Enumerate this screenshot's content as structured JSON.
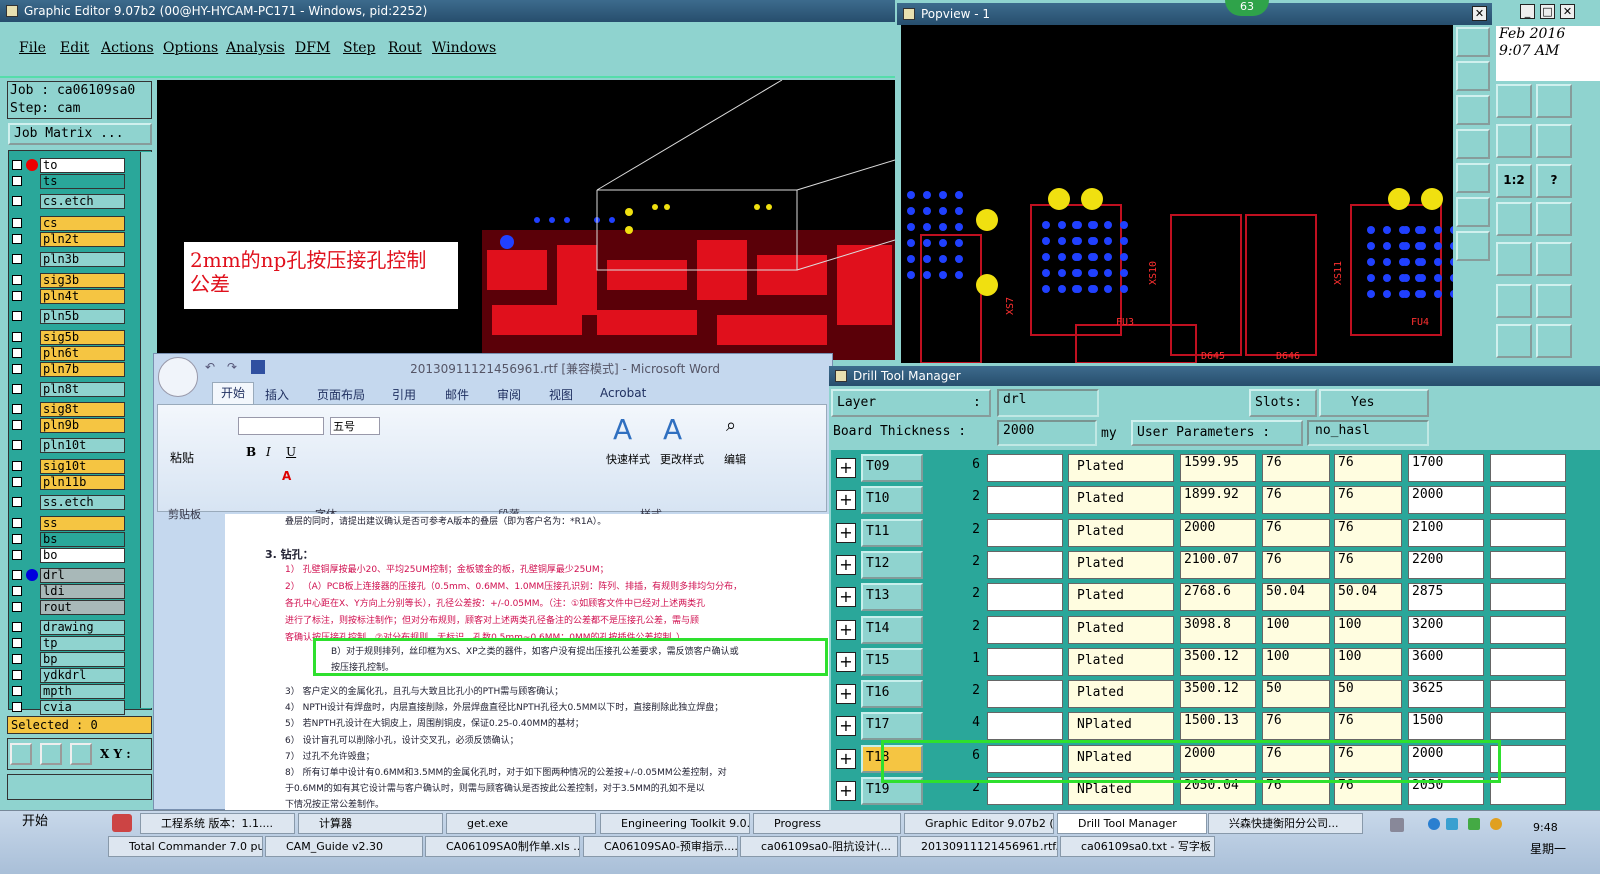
{
  "ge": {
    "title": "Graphic Editor 9.07b2 (00@HY-HYCAM-PC171 - Windows, pid:2252)",
    "menu": [
      "File",
      "Edit",
      "Actions",
      "Options",
      "Analysis",
      "DFM",
      "Step",
      "Rout",
      "Windows"
    ],
    "job": "Job : ca06109sa0",
    "step": "Step: cam",
    "job_matrix": "Job Matrix ...",
    "layers": [
      "to",
      "ts",
      "cs.etch",
      "cs",
      "pln2t",
      "pln3b",
      "sig3b",
      "pln4t",
      "pln5b",
      "sig5b",
      "pln6t",
      "pln7b",
      "pln8t",
      "sig8t",
      "pln9b",
      "pln10t",
      "sig10t",
      "pln11b",
      "ss.etch",
      "ss",
      "bs",
      "bo",
      "drl",
      "ldi",
      "rout",
      "drawing",
      "tp",
      "bp",
      "ydkdrl",
      "mpth",
      "cvia"
    ],
    "selected": "Selected : 0",
    "xy": "X Y :",
    "note": "2mm的np孔按压接孔控制\n公差"
  },
  "popview": {
    "title": "Popview - 1",
    "badge": "63",
    "labels": [
      "XS7",
      "XS10",
      "XS11",
      "FU3",
      "FU4",
      "D645",
      "D646"
    ],
    "date": "Feb 2016",
    "time": "9:07 AM"
  },
  "word": {
    "title": "20130911121456961.rtf [兼容模式] - Microsoft Word",
    "tabs": [
      "开始",
      "插入",
      "页面布局",
      "引用",
      "邮件",
      "审阅",
      "视图",
      "Acrobat"
    ],
    "groups": [
      "剪贴板",
      "字体",
      "段落",
      "样式",
      "编辑"
    ],
    "paste": "粘贴",
    "fontsize": "五号",
    "quick_style": "快速样式",
    "change_style": "更改样式",
    "edit": "编辑",
    "lines": [
      "叠层的同时，请提出建议确认是否可参考A版本的叠层（即为客户名为：*R1A）。",
      "3.   钻孔：",
      "1） 孔壁铜厚按最小20、平均25UM控制；金板镀金的板，孔壁铜厚最少25UM；",
      "2） （A）PCB板上连接器的压接孔（0.5mm、0.6MM、1.0MM压接孔识别：阵列、排插，有规则多排均匀分布，",
      "各孔中心距在X、Y方向上分别等长），孔径公差按：+/-0.05MM。（注：①如顾客文件中已经对上述两类孔",
      "进行了标注，则按标注制作；但对分布规则，顾客对上述两类孔径备注的公差都不是压接孔公差，需与顾",
      "客确认按压接孔控制。②对分布规则、无标识、孔数0.5mm~0.6MM：0MM的孔按插件公差控制。）",
      "B）对于规则排列，丝印框为XS、XP之类的器件，如客户没有提出压接孔公差要求，需反馈客户确认或",
      "按压接孔控制。",
      "3） 客户定义的金属化孔，且孔与大致且比孔小的PTH需与顾客确认；",
      "4） NPTH设计有焊盘时，内层直接削除，外层焊盘直径比NPTH孔径大0.5MM以下时，直接削除此独立焊盘；",
      "5） 若NPTH孔设计在大铜皮上，周围削铜皮，保证0.25-0.40MM的基材；",
      "6） 设计盲孔可以削除小孔，设计交叉孔，必须反馈确认；",
      "7） 过孔不允许毁盘；",
      "8） 所有订单中设计有0.6MM和3.5MM的金属化孔时，对于如下图两种情况的公差按+/-0.05MM公差控制，对",
      "于0.6MM的如有其它设计需与客户确认时，则需与顾客确认是否按此公差控制，对于3.5MM的孔如不是以",
      "下情况按正常公差制作。"
    ]
  },
  "dtm": {
    "title": "Drill Tool Manager",
    "layer_label": "Layer",
    "layer_sep": ":",
    "layer_value": "drl",
    "slots_label": "Slots:",
    "slots_value": "Yes",
    "thick_label": "Board Thickness :",
    "thick_value": "2000",
    "thick_unit": "my",
    "user_label": "User Parameters :",
    "user_value": "no_hasl",
    "rows": [
      {
        "t": "T09",
        "c": "6",
        "type": "Plated",
        "d": "1599.95",
        "p": "76",
        "m": "76",
        "f": "1700"
      },
      {
        "t": "T10",
        "c": "2",
        "type": "Plated",
        "d": "1899.92",
        "p": "76",
        "m": "76",
        "f": "2000"
      },
      {
        "t": "T11",
        "c": "2",
        "type": "Plated",
        "d": "2000",
        "p": "76",
        "m": "76",
        "f": "2100"
      },
      {
        "t": "T12",
        "c": "2",
        "type": "Plated",
        "d": "2100.07",
        "p": "76",
        "m": "76",
        "f": "2200"
      },
      {
        "t": "T13",
        "c": "2",
        "type": "Plated",
        "d": "2768.6",
        "p": "50.04",
        "m": "50.04",
        "f": "2875"
      },
      {
        "t": "T14",
        "c": "2",
        "type": "Plated",
        "d": "3098.8",
        "p": "100",
        "m": "100",
        "f": "3200"
      },
      {
        "t": "T15",
        "c": "1",
        "type": "Plated",
        "d": "3500.12",
        "p": "100",
        "m": "100",
        "f": "3600"
      },
      {
        "t": "T16",
        "c": "2",
        "type": "Plated",
        "d": "3500.12",
        "p": "50",
        "m": "50",
        "f": "3625"
      },
      {
        "t": "T17",
        "c": "4",
        "type": "NPlated",
        "d": "1500.13",
        "p": "76",
        "m": "76",
        "f": "1500"
      },
      {
        "t": "T18",
        "c": "6",
        "type": "NPlated",
        "d": "2000",
        "p": "76",
        "m": "76",
        "f": "2000"
      },
      {
        "t": "T19",
        "c": "2",
        "type": "NPlated",
        "d": "2050.04",
        "p": "76",
        "m": "76",
        "f": "2050"
      }
    ]
  },
  "taskbar": {
    "start": "开始",
    "row1": [
      "工程系统  版本：1.1....",
      "计算器",
      "get.exe",
      "Engineering Toolkit 9.0...",
      "Progress",
      "Graphic Editor 9.07b2 (...",
      "Drill Tool Manager",
      "兴森快捷衡阳分公司..."
    ],
    "row2": [
      "Total Commander 7.0 pu...",
      "CAM_Guide v2.30",
      "CA06109SA0制作单.xls ...",
      "CA06109SA0-预审指示....",
      "ca06109sa0-阻抗设计(...",
      "20130911121456961.rtf...",
      "ca06109sa0.txt - 写字板"
    ],
    "clock": "9:48",
    "day": "星期一"
  }
}
